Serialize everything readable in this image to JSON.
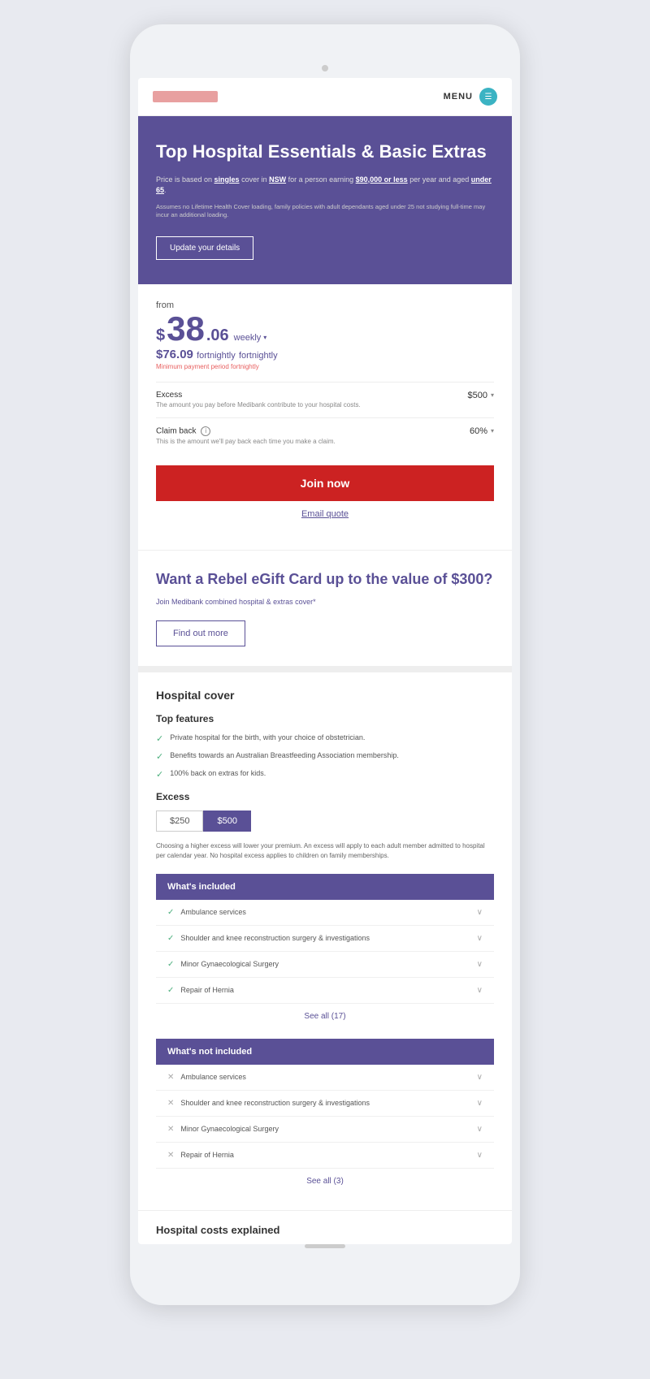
{
  "phone": {
    "header": {
      "menu_label": "MENU"
    },
    "hero": {
      "title": "Top Hospital Essentials & Basic Extras",
      "description_main": "Price is based on singles cover in NSW for a person earning $90,000 or less per year and aged under 65.",
      "description_fine": "Assumes no Lifetime Health Cover loading, family policies with adult dependants aged under 25 not studying full-time may incur an additional loading.",
      "update_btn": "Update your details"
    },
    "pricing": {
      "from_label": "from",
      "dollar": "$",
      "price_whole": "38",
      "price_cents": ".06",
      "period_weekly": "weekly",
      "price_fortnightly": "$76.09",
      "period_fortnightly": "fortnightly",
      "min_payment": "Minimum payment period fortnightly",
      "excess_label": "Excess",
      "excess_sublabel": "The amount you pay before Medibank contribute to your hospital costs.",
      "excess_value": "$500",
      "claimback_label": "Claim back",
      "claimback_sublabel": "This is the amount we'll pay back each time you make a claim.",
      "claimback_value": "60%",
      "join_btn": "Join now",
      "email_quote": "Email quote"
    },
    "gift": {
      "title": "Want a Rebel eGift Card up to the value of $300?",
      "description": "Join Medibank combined hospital & extras cover*",
      "find_out_btn": "Find out more"
    },
    "hospital": {
      "section_title": "Hospital cover",
      "features_title": "Top features",
      "features": [
        "Private hospital for the birth, with your choice of obstetrician.",
        "Benefits towards an Australian Breastfeeding Association membership.",
        "100% back on extras for kids."
      ],
      "excess_title": "Excess",
      "excess_options": [
        "$250",
        "$500"
      ],
      "excess_active": "$500",
      "excess_note": "Choosing a higher excess will lower your premium. An excess will apply to each adult member admitted to hospital per calendar year. No hospital excess applies to children on family memberships.",
      "whats_included_title": "What's included",
      "included_items": [
        "Ambulance services",
        "Shoulder and knee reconstruction surgery & investigations",
        "Minor Gynaecological Surgery",
        "Repair of Hernia"
      ],
      "see_all_included": "See all (17)",
      "whats_not_included_title": "What's not included",
      "not_included_items": [
        "Ambulance services",
        "Shoulder and knee reconstruction surgery & investigations",
        "Minor Gynaecological Surgery",
        "Repair of Hernia"
      ],
      "see_all_not_included": "See all (3)",
      "hospital_costs_title": "Hospital costs explained"
    }
  }
}
